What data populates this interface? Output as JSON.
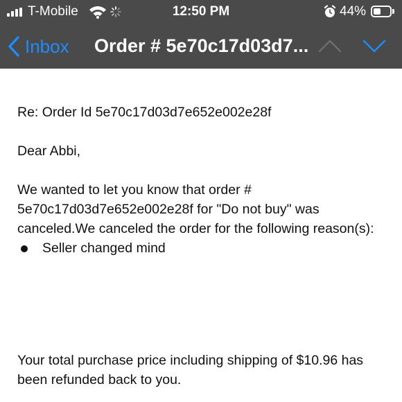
{
  "status_bar": {
    "carrier": "T-Mobile",
    "time": "12:50 PM",
    "battery_percent": "44%",
    "battery_level": 0.44,
    "icons": [
      "signal-bars-icon",
      "wifi-icon",
      "activity-spinner-icon",
      "alarm-clock-icon",
      "battery-icon"
    ]
  },
  "nav": {
    "back_label": "Inbox",
    "title": "Order # 5e70c17d03d7...",
    "icons": [
      "chevron-left-icon",
      "chevron-up-icon",
      "chevron-down-icon"
    ]
  },
  "message": {
    "subject_line": "Re: Order Id 5e70c17d03d7e652e002e28f",
    "greeting": "Dear Abbi,",
    "body": "We wanted to let you know that order # 5e70c17d03d7e652e002e28f for \"Do not buy\" was canceled.We canceled the order for the following reason(s):",
    "reasons": [
      "Seller changed mind"
    ],
    "refund": "Your total purchase price including shipping of $10.96 has been refunded back to you."
  },
  "colors": {
    "header_bg": "#4a4a4a",
    "accent": "#1c8cff",
    "text": "#111111",
    "background": "#ffffff"
  }
}
